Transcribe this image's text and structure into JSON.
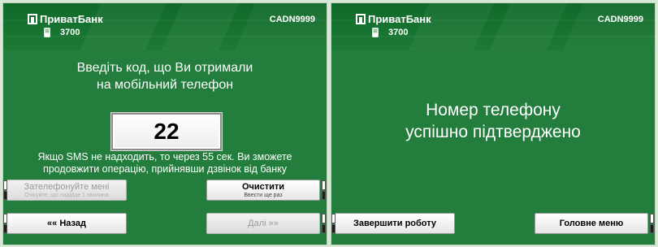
{
  "left_screen": {
    "bank_name": "ПриватБанк",
    "terminal_id": "CADN9999",
    "phone_number": "3700",
    "prompt_line1": "Введіть код, що Ви отримали",
    "prompt_line2": "на мобільний телефон",
    "code_value": "22",
    "sms_note_line1": "Якщо SMS не надходить, то через 55 сек. Ви зможете",
    "sms_note_line2": "продовжити операцію, прийнявши дзвінок від банку",
    "call_me_button": {
      "label": "Зателефонуйте мені",
      "sublabel": "Очікуйте, що надійде 1 хвилина",
      "state": "disabled"
    },
    "clear_button": {
      "label": "Очистити",
      "sublabel": "Ввести ще раз",
      "state": "enabled"
    },
    "back_button": {
      "label": "««  Назад",
      "state": "enabled"
    },
    "next_button": {
      "label": "Далі  »»",
      "state": "disabled"
    }
  },
  "right_screen": {
    "bank_name": "ПриватБанк",
    "terminal_id": "CADN9999",
    "phone_number": "3700",
    "message_line1": "Номер телефону",
    "message_line2": "успішно підтверджено",
    "finish_button": {
      "label": "Завершити роботу"
    },
    "main_menu_button": {
      "label": "Головне меню"
    }
  },
  "colors": {
    "screen_green": "#237d3c",
    "header_green": "#0f6a2a",
    "button_face": "#ffffff",
    "text_white": "#ffffff"
  },
  "icons": [
    "privatbank-logo-icon",
    "mobile-phone-icon"
  ]
}
